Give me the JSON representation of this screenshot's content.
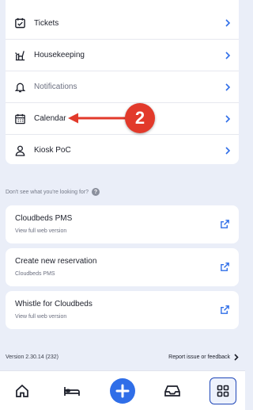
{
  "menu": {
    "items": [
      {
        "label": "Tickets",
        "icon": "ticket-checkbox-icon"
      },
      {
        "label": "Housekeeping",
        "icon": "housekeeping-icon"
      },
      {
        "label": "Notifications",
        "icon": "bell-icon"
      },
      {
        "label": "Calendar",
        "icon": "calendar-icon"
      },
      {
        "label": "Kiosk PoC",
        "icon": "user-icon"
      }
    ]
  },
  "annotation": {
    "step_number": "2"
  },
  "help": {
    "text": "Don't see what you're looking for?",
    "icon_glyph": "?"
  },
  "links": [
    {
      "title": "Cloudbeds PMS",
      "subtitle": "View full web version"
    },
    {
      "title": "Create new reservation",
      "subtitle": "Cloudbeds PMS"
    },
    {
      "title": "Whistle for Cloudbeds",
      "subtitle": "View full web version"
    }
  ],
  "footer": {
    "version": "Version 2.30.14 (232)",
    "report": "Report issue or feedback"
  },
  "tabbar": {
    "tabs": [
      "home-icon",
      "bed-icon",
      "add-icon",
      "inbox-icon",
      "apps-grid-icon"
    ],
    "active": "apps-grid-icon"
  },
  "colors": {
    "accent": "#2f6ee8",
    "annotation": "#e23a2b",
    "background": "#eaeef8"
  }
}
